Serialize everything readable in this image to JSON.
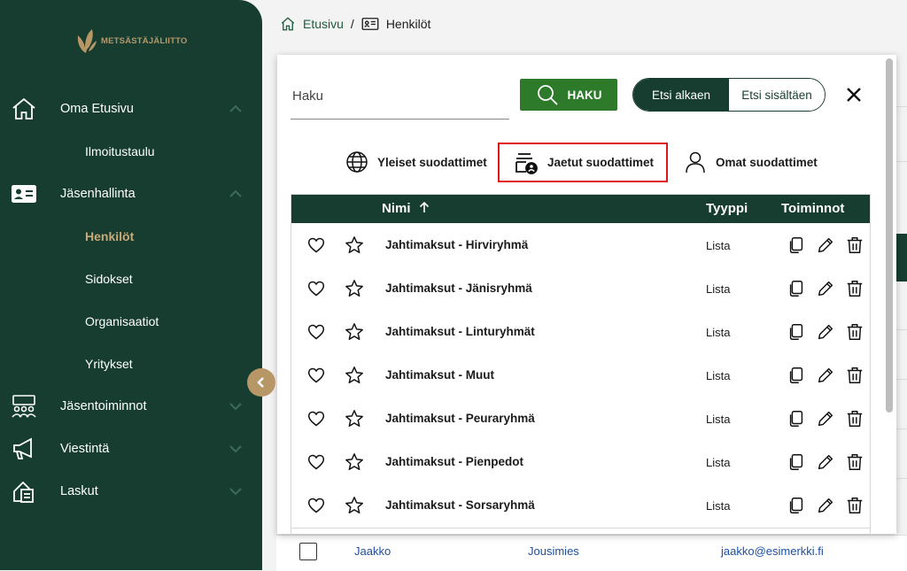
{
  "sidebar": {
    "logo_text": "METSÄSTÄJÄLIITTO",
    "items": [
      {
        "label": "Oma Etusivu",
        "icon": "home-icon"
      },
      {
        "label": "Jäsenhallinta",
        "icon": "id-card-icon"
      },
      {
        "label": "Jäsentoiminnot",
        "icon": "group-icon"
      },
      {
        "label": "Viestintä",
        "icon": "megaphone-icon"
      },
      {
        "label": "Laskut",
        "icon": "invoice-icon"
      }
    ],
    "sub_items": [
      {
        "label": "Ilmoitustaulu"
      },
      {
        "label": "Henkilöt"
      },
      {
        "label": "Sidokset"
      },
      {
        "label": "Organisaatiot"
      },
      {
        "label": "Yritykset"
      }
    ],
    "colors": {
      "background": "#163d30",
      "accent": "#b89767"
    }
  },
  "breadcrumb": {
    "home": "Etusivu",
    "separator": "/",
    "current": "Henkilöt"
  },
  "modal": {
    "search_placeholder": "Haku",
    "search_button": "HAKU",
    "toggle": {
      "starts_with": "Etsi alkaen",
      "contains": "Etsi sisältäen",
      "selected": "Etsi alkaen"
    },
    "filter_tabs": [
      {
        "label": "Yleiset suodattimet",
        "icon": "globe-icon"
      },
      {
        "label": "Jaetut suodattimet",
        "icon": "shared-filter-icon",
        "highlighted": true
      },
      {
        "label": "Omat suodattimet",
        "icon": "person-icon"
      }
    ],
    "table": {
      "headers": {
        "name": "Nimi",
        "type": "Tyyppi",
        "actions": "Toiminnot"
      },
      "sort": "ascending",
      "rows": [
        {
          "name": "Jahtimaksut - Hirviryhmä",
          "type": "Lista"
        },
        {
          "name": "Jahtimaksut - Jänisryhmä",
          "type": "Lista"
        },
        {
          "name": "Jahtimaksut - Linturyhmät",
          "type": "Lista"
        },
        {
          "name": "Jahtimaksut - Muut",
          "type": "Lista"
        },
        {
          "name": "Jahtimaksut - Peuraryhmä",
          "type": "Lista"
        },
        {
          "name": "Jahtimaksut - Pienpedot",
          "type": "Lista"
        },
        {
          "name": "Jahtimaksut - Sorsaryhmä",
          "type": "Lista"
        }
      ]
    },
    "colors": {
      "primary_button": "#2d7a2b",
      "header": "#163d30",
      "highlight_border": "#e0161d"
    }
  },
  "background_row": {
    "first_name": "Jaakko",
    "last_name": "Jousimies",
    "email": "jaakko@esimerkki.fi"
  }
}
